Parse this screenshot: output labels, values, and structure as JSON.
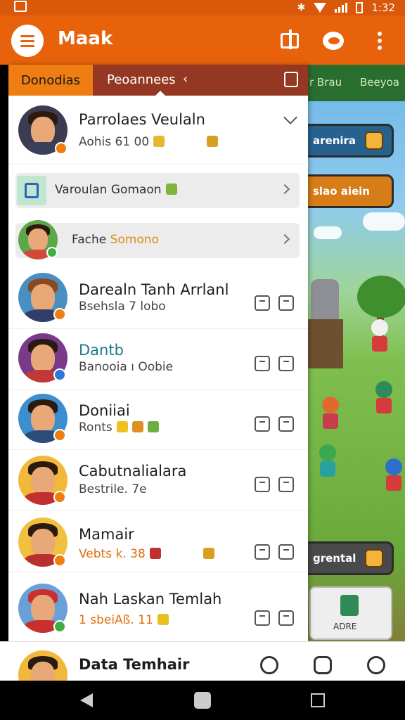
{
  "status_bar": {
    "time": "1:32"
  },
  "app_bar": {
    "title": "Maak"
  },
  "drawer": {
    "tabs": [
      {
        "label": "Donodias"
      },
      {
        "label": "Peoannees"
      }
    ],
    "profile": {
      "name": "Parrolaes Veulaln",
      "subtitle": "Aohis 61 00"
    },
    "rows": [
      {
        "label": "Varoulan Gomaon"
      },
      {
        "label_main": "Fache",
        "label_accent": "Somono"
      }
    ],
    "contacts": [
      {
        "name": "Darealn Tanh Arrlanl",
        "subtitle": "Bsehsla 7 lobo"
      },
      {
        "name": "Dantb",
        "subtitle": "Banooia ı Oobie"
      },
      {
        "name": "Doniiai",
        "subtitle": "Ronts"
      },
      {
        "name": "Cabutnalialara",
        "subtitle": "Bestrile. 7e"
      },
      {
        "name": "Mamair",
        "subtitle": "Vebts k. 38"
      },
      {
        "name": "Nah Laskan Temlah",
        "subtitle": "1 sbeiAß. 11"
      }
    ]
  },
  "game_panel": {
    "tabs": [
      {
        "label": "r Brau"
      },
      {
        "label": "Beeyoa"
      }
    ],
    "buttons": [
      {
        "label": "arenira"
      },
      {
        "label": "slao aiein"
      },
      {
        "label": "grental"
      }
    ],
    "card_label": "ADRE"
  },
  "bottom_card": {
    "name": "Data Temhair"
  },
  "colors": {
    "app_bar": "#e8620c",
    "tab_active": "#ef7d12",
    "tab_inactive": "#953823",
    "accent_text": "#e08a10"
  }
}
